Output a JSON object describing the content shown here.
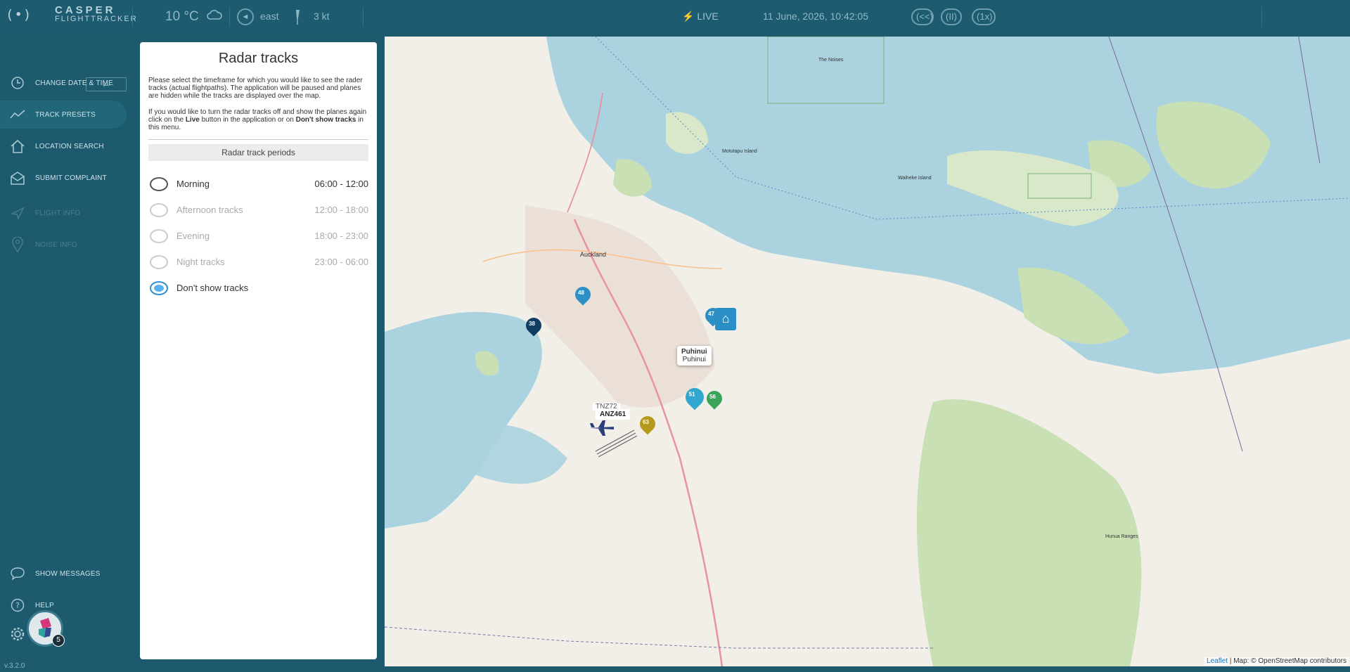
{
  "app": {
    "logo_mark": "(•)",
    "logo_line1": "CASPER",
    "logo_line2": "FLIGHTTRACKER",
    "version": "v.3.2.0"
  },
  "topbar": {
    "temperature": "10 °C",
    "wind_direction": "east",
    "wind_speed": "3 kt",
    "live_label": "LIVE",
    "datetime": "11 June, 2026, 10:42:05",
    "rewind_label": "<<",
    "pause_label": "II",
    "speed_label": "1x"
  },
  "sidebar": {
    "collapse_label": "←",
    "items": [
      {
        "label": "CHANGE DATE & TIME",
        "icon": "clock-icon"
      },
      {
        "label": "TRACK PRESETS",
        "icon": "trend-line-icon"
      },
      {
        "label": "LOCATION SEARCH",
        "icon": "home-icon"
      },
      {
        "label": "SUBMIT COMPLAINT",
        "icon": "envelope-icon"
      },
      {
        "label": "FLIGHT INFO",
        "icon": "plane-icon"
      },
      {
        "label": "NOISE INFO",
        "icon": "location-pin-icon"
      },
      {
        "label": "SHOW MESSAGES",
        "icon": "speech-bubble-icon"
      },
      {
        "label": "HELP",
        "icon": "question-icon"
      }
    ],
    "notification_count": "5"
  },
  "panel": {
    "title": "Radar tracks",
    "intro": "Please select the timeframe for which you would like to see the rader tracks (actual flightpaths). The application will be paused and planes are hidden while the tracks are displayed over the map.",
    "hint_pre": "If you would like to turn the radar tracks off and show the planes again click on the ",
    "hint_live": "Live",
    "hint_mid": " button in the application or on ",
    "hint_dont": "Don't show tracks",
    "hint_post": " in this menu.",
    "section_header": "Radar track periods",
    "options": [
      {
        "name": "Morning",
        "time": "06:00 - 12:00"
      },
      {
        "name": "Afternoon tracks",
        "time": "12:00 - 18:00"
      },
      {
        "name": "Evening",
        "time": "18:00 - 23:00"
      },
      {
        "name": "Night tracks",
        "time": "23:00 - 06:00"
      },
      {
        "name": "Don't show tracks",
        "time": ""
      }
    ],
    "selected": "Don't show tracks"
  },
  "map": {
    "popup_title": "Puhinui",
    "popup_sub": "Puhinui",
    "flight_label": "ANZ461",
    "flight_label_partial": "TNZ72",
    "markers": [
      {
        "label": "48",
        "color": "#2d8fc4"
      },
      {
        "label": "38",
        "color": "#0f3e63"
      },
      {
        "label": "47",
        "color": "#2d8fc4"
      },
      {
        "label": "51",
        "color": "#2fa7cf"
      },
      {
        "label": "56",
        "color": "#3aa45a"
      },
      {
        "label": "63",
        "color": "#b59a1b"
      }
    ],
    "places": [
      "Auckland",
      "Waiheke Island",
      "Motutapu Island",
      "The Noises",
      "Hunua Ranges"
    ],
    "attribution_link": "Leaflet",
    "attribution_text": " | Map: © OpenStreetMap contributors"
  }
}
